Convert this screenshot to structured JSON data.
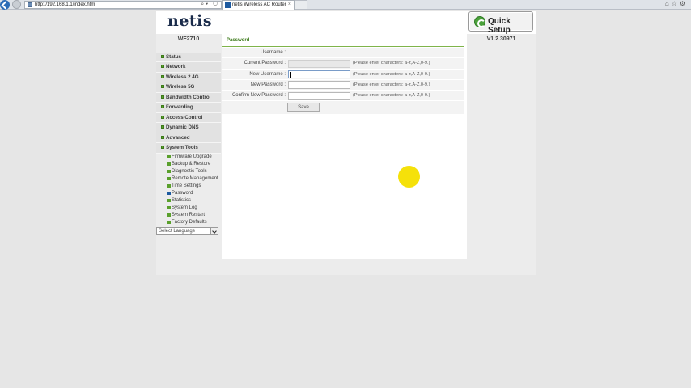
{
  "browser": {
    "address": "http://192.168.1.1/index.htm",
    "tab_title": "netis Wireless AC Router"
  },
  "header": {
    "logo": "netis",
    "quick_setup": "Quick Setup",
    "model": "WF2710",
    "version": "V1.2.30971"
  },
  "sidebar": {
    "items": [
      {
        "label": "Status"
      },
      {
        "label": "Network"
      },
      {
        "label": "Wireless 2.4G"
      },
      {
        "label": "Wireless 5G"
      },
      {
        "label": "Bandwidth Control"
      },
      {
        "label": "Forwarding"
      },
      {
        "label": "Access Control"
      },
      {
        "label": "Dynamic DNS"
      },
      {
        "label": "Advanced"
      },
      {
        "label": "System Tools"
      }
    ],
    "sub_items": [
      {
        "label": "Firmware Upgrade"
      },
      {
        "label": "Backup & Restore"
      },
      {
        "label": "Diagnostic Tools"
      },
      {
        "label": "Remote Management"
      },
      {
        "label": "Time Settings"
      },
      {
        "label": "Password"
      },
      {
        "label": "Statistics"
      },
      {
        "label": "System Log"
      },
      {
        "label": "System Restart"
      },
      {
        "label": "Factory Defaults"
      }
    ],
    "language_select": "Select Language"
  },
  "main": {
    "section_title": "Password",
    "fields": [
      {
        "label": "Username :",
        "value": "",
        "hint": ""
      },
      {
        "label": "Current Password :",
        "value": "",
        "hint": "(Please enter characters: a-z,A-Z,0-9.)"
      },
      {
        "label": "New Username :",
        "value": "",
        "hint": "(Please enter characters: a-z,A-Z,0-9.)"
      },
      {
        "label": "New Password :",
        "value": "",
        "hint": "(Please enter characters: a-z,A-Z,0-9.)"
      },
      {
        "label": "Confirm New Password :",
        "value": "",
        "hint": "(Please enter characters: a-z,A-Z,0-9.)"
      }
    ],
    "save_label": "Save"
  }
}
